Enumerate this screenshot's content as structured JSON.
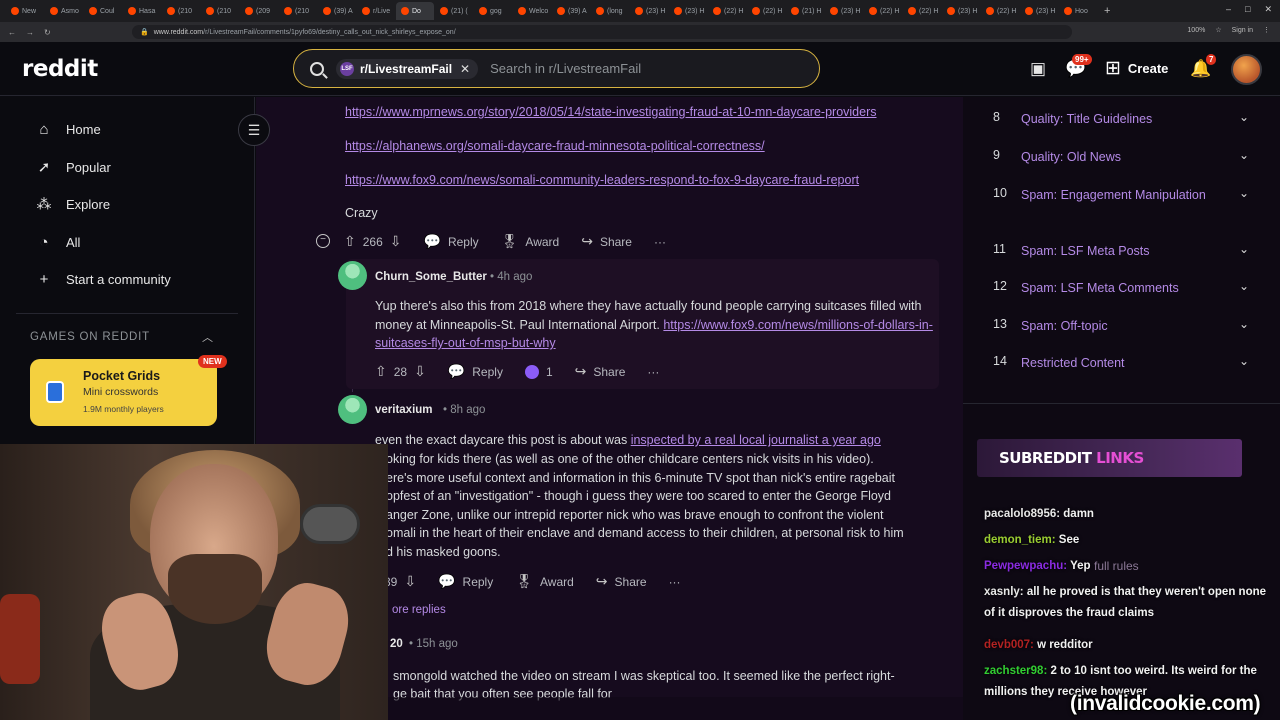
{
  "browser": {
    "tabs": [
      "New",
      "Asmo",
      "Coul",
      "Hasa",
      "(210",
      "(210",
      "(209",
      "(210",
      "(39) A",
      "r/Live",
      "Do",
      "(21) (",
      "gog",
      "Welco",
      "(39) A",
      "(long",
      "(23) H",
      "(23) H",
      "(22) H",
      "(22) H",
      "(21) H",
      "(23) H",
      "(22) H",
      "(22) H",
      "(23) H",
      "(22) H",
      "(23) H",
      "Hoo"
    ],
    "active_tab_index": 10,
    "url_host": "www.reddit.com",
    "url_path": "/r/LivestreamFail/comments/1pyfo69/destiny_calls_out_nick_shirleys_expose_on/",
    "zoom": "100%",
    "signin_label": "Sign in"
  },
  "header": {
    "logo": "reddit",
    "search_chip": "r/LivestreamFail",
    "search_chip_close": "✕",
    "search_placeholder": "Search in r/LivestreamFail",
    "chat_badge": "99+",
    "notif_badge": "7",
    "create_label": "Create"
  },
  "left_nav": {
    "items": [
      {
        "label": "Home",
        "icon": "home-icon"
      },
      {
        "label": "Popular",
        "icon": "popular-icon"
      },
      {
        "label": "Explore",
        "icon": "explore-icon"
      },
      {
        "label": "All",
        "icon": "all-icon"
      },
      {
        "label": "Start a community",
        "icon": "plus-icon"
      }
    ],
    "games_header": "GAMES ON REDDIT",
    "game": {
      "title": "Pocket Grids",
      "subtitle": "Mini crosswords",
      "players": "1.9M monthly players",
      "badge": "NEW"
    }
  },
  "main": {
    "links": [
      "https://www.mprnews.org/story/2018/05/14/state-investigating-fraud-at-10-mn-daycare-providers",
      "https://alphanews.org/somali-daycare-fraud-minnesota-political-correctness/",
      "https://www.fox9.com/news/somali-community-leaders-respond-to-fox-9-daycare-fraud-report"
    ],
    "crazy_text": "Crazy",
    "comment0_actions": {
      "votes": "266",
      "reply": "Reply",
      "award": "Award",
      "share": "Share",
      "more": "···"
    },
    "comment1": {
      "author": "Churn_Some_Butter",
      "time": "• 4h ago",
      "text_part1": "Yup there's also this from 2018 where they have actually found people carrying suitcases filled with money at Minneapolis-St. Paul International Airport. ",
      "link": "https://www.fox9.com/news/millions-of-dollars-in-suitcases-fly-out-of-msp-but-why",
      "votes": "28",
      "reply": "Reply",
      "award_count": "1",
      "share": "Share",
      "more": "···"
    },
    "comment2": {
      "author": "veritaxium",
      "time": "• 8h ago",
      "text_part1": "even the exact daycare this post is about was ",
      "link": "inspected by a real local journalist a year ago",
      "line2": "oking for kids there (as well as one of the other childcare centers nick visits in his video).",
      "line3": "ere's more useful context and information in this 6-minute TV spot than nick's entire ragebait",
      "line4": "opfest of an \"investigation\" - though i guess they were too scared to enter the George Floyd",
      "line5": "anger Zone, unlike our intrepid reporter nick who was brave enough to confront the violent",
      "line6": "omali in the heart of their enclave and demand access to their children, at personal risk to him",
      "line7": "d his masked goons.",
      "votes": "39",
      "reply": "Reply",
      "award": "Award",
      "share": "Share",
      "more": "···"
    },
    "more_replies": "ore replies",
    "comment3": {
      "author_fragment": "20",
      "time": "• 15h ago",
      "line1": "smongold watched the video on stream I was skeptical too. It seemed like the perfect right-",
      "line2": "ge bait that you often see people fall for"
    }
  },
  "rules": [
    {
      "num": "8",
      "title": "Quality: Title Guidelines"
    },
    {
      "num": "9",
      "title": "Quality: Old News"
    },
    {
      "num": "10",
      "title": "Spam: Engagement Manipulation"
    },
    {
      "num": "11",
      "title": "Spam: LSF Meta Posts"
    },
    {
      "num": "12",
      "title": "Spam: LSF Meta Comments"
    },
    {
      "num": "13",
      "title": "Spam: Off-topic"
    },
    {
      "num": "14",
      "title": "Restricted Content"
    }
  ],
  "links_banner": {
    "part1": "SUBREDDIT ",
    "part2": "LINKS"
  },
  "full_rules": "full rules",
  "chat": [
    {
      "user": "pacalolo8956:",
      "msg": "damn",
      "color": "#e8e8e8"
    },
    {
      "user": "demon_tiem:",
      "msg": "See",
      "color": "#9acd32"
    },
    {
      "user": "Pewpewpachu:",
      "msg": "Yep",
      "color": "#8a2be2"
    },
    {
      "user": "xasnly:",
      "msg": "all he proved is that they weren't open none of it disproves the fraud claims",
      "color": "#e8e8e8"
    },
    {
      "user": "devb007:",
      "msg": "w redditor",
      "color": "#b22222"
    },
    {
      "user": "zachster98:",
      "msg": "2 to 10 isnt too weird. Its weird for the millions they receive however",
      "color": "#32cd32"
    }
  ],
  "watermark": "(invalidcookie.com)"
}
